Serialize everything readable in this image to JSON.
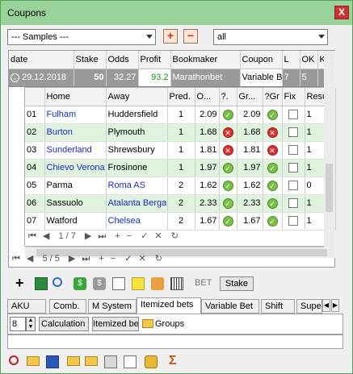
{
  "window": {
    "title": "Coupons",
    "close_label": "X"
  },
  "filters": {
    "samples": "--- Samples ---",
    "scope": "all",
    "add_label": "+",
    "remove_label": "−"
  },
  "coupon_table": {
    "headers": [
      "date",
      "Stake",
      "Odds",
      "Profit",
      "Bookmaker",
      "Coupon",
      "L",
      "OK",
      "K"
    ],
    "row": {
      "date": "29.12.2018",
      "stake": "50",
      "odds": "32.27",
      "profit": "93.2",
      "bookmaker": "Marathonbet",
      "coupon": "Variable B",
      "l": "7",
      "ok": "5"
    }
  },
  "games_table": {
    "headers": [
      "Home",
      "Away",
      "Pred.",
      "O...",
      "?.",
      "Gr...",
      "?Gr",
      "Fix",
      "Resu"
    ],
    "rows": [
      {
        "num": "01",
        "home": "Fulham",
        "away": "Huddersfield",
        "pred": "1",
        "odds": "2.09",
        "s1": "ok",
        "gr": "2.09",
        "s2": "ok",
        "home_blue": true,
        "away_blue": false
      },
      {
        "num": "02",
        "home": "Burton",
        "away": "Plymouth",
        "pred": "1",
        "odds": "1.68",
        "s1": "no",
        "gr": "1.68",
        "s2": "no",
        "home_blue": true,
        "away_blue": false
      },
      {
        "num": "03",
        "home": "Sunderland",
        "away": "Shrewsbury",
        "pred": "1",
        "odds": "1.81",
        "s1": "no",
        "gr": "1.81",
        "s2": "no",
        "home_blue": true,
        "away_blue": false
      },
      {
        "num": "04",
        "home": "Chievo Verona",
        "away": "Frosinone",
        "pred": "1",
        "odds": "1.97",
        "s1": "ok",
        "gr": "1.97",
        "s2": "ok",
        "home_blue": true,
        "away_blue": false
      },
      {
        "num": "05",
        "home": "Parma",
        "away": "Roma AS",
        "pred": "2",
        "odds": "1.62",
        "s1": "ok",
        "gr": "1.62",
        "s2": "ok",
        "home_blue": false,
        "away_blue": true
      },
      {
        "num": "06",
        "home": "Sassuolo",
        "away": "Atalanta Berga",
        "pred": "2",
        "odds": "2.33",
        "s1": "ok",
        "gr": "2.33",
        "s2": "ok",
        "home_blue": false,
        "away_blue": true
      },
      {
        "num": "07",
        "home": "Watford",
        "away": "Chelsea",
        "pred": "2",
        "odds": "1.67",
        "s1": "ok",
        "gr": "1.67",
        "s2": "ok",
        "home_blue": false,
        "away_blue": true
      }
    ],
    "results_partial": [
      "1",
      "1",
      "1",
      "1",
      "0",
      "1",
      "1"
    ]
  },
  "inner_nav": {
    "page": "1 / 7"
  },
  "outer_nav": {
    "page": "5 / 5"
  },
  "toolbar": {
    "bet_label": "BET",
    "stake_label": "Stake"
  },
  "tabs": [
    "AKU",
    "Comb.",
    "M System",
    "Itemized bets",
    "Variable Bet",
    "Shift",
    "Supe"
  ],
  "active_tab": "Itemized bets",
  "itemized": {
    "count": "8",
    "calc_label": "Calculation",
    "itemized_label": "Itemized bet",
    "groups_label": "Groups"
  },
  "colors": {
    "title_bar": "#9ad39a",
    "accent_red": "#d03010",
    "link_blue": "#1a2cbe",
    "row_green": "#dff3df",
    "ok": "#7ac043",
    "no": "#d83030"
  }
}
